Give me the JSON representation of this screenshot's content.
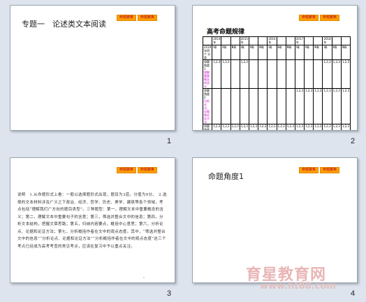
{
  "tags": [
    "命题聚焦",
    "命题聚焦"
  ],
  "slides": [
    {
      "number": "1",
      "title": "专题一　论述类文本阅读"
    },
    {
      "number": "2",
      "title": "高考命题规律",
      "table": {
        "header_row1": [
          "",
          "2014 年",
          "",
          "",
          "2015 年",
          "",
          "",
          "2016 年",
          "",
          "",
          "2017 年",
          "",
          "",
          "2018 年",
          "",
          ""
        ],
        "header_row2": [
          "2019 年四个 分类",
          "Ⅰ卷",
          "Ⅱ卷",
          "Ⅲ卷",
          "Ⅰ卷",
          "Ⅱ卷",
          "Ⅲ卷",
          "Ⅰ卷",
          "Ⅱ卷",
          "Ⅲ卷",
          "Ⅰ卷",
          "Ⅱ卷",
          "Ⅲ卷",
          "Ⅰ卷",
          "Ⅱ卷",
          "Ⅲ卷"
        ],
        "rows": [
          {
            "label": "命题角度1",
            "desc": "理解重要概念的含义",
            "cells": [
              "1,2,3",
              "1,2,3",
              "",
              "1,2,3",
              "",
              "",
              "",
              "",
              "",
              "",
              "",
              "",
              "1,2,3",
              "1,2,3",
              "1,2,3"
            ]
          },
          {
            "label": "命题角度2",
            "desc": "分析论点、论据和论证方法",
            "cells": [
              "",
              "",
              "",
              "",
              "",
              "",
              "",
              "",
              "",
              "1,2,3",
              "1,2,3",
              "1,2,3",
              "1,2,3",
              "1,2,3",
              "1,2,3"
            ]
          },
          {
            "label": "命题角度3",
            "desc": "分析概括作者在文中的观点态度",
            "cells": [
              "1,2,3",
              "1,2,3",
              "1,2,3",
              "1,2,3",
              "1,2,3",
              "1,2,3",
              "1,2,3",
              "1,2,3",
              "1,2,3",
              "1,2,3",
              "1,2,3",
              "1,2,3",
              "1,2,3",
              "1,2,3",
              "1,2,3"
            ]
          }
        ]
      }
    },
    {
      "number": "3",
      "paragraph": "说明　1.从命题形式上看：一般以选择题形式出现，题目为3道，分值为9分。　2.选择的文本材料涉及广义之下政治、经济、哲学、历史、美学、建筑等各个领域，考点包括“理解我们广方向的题目类型”。三种题型：第一，理解文本中重要概念的含义；第二，理解文本中重要句子的含意；第三，筛选并整合文中的信息；第四，分析文本结构，把握文章思路；第五，归纳内容要点，概括中心意思；第六，分析论点、论据和论证方法；第七，分析概括作者在文中的观点态度。其中，“筛选并整合文中的信息”“分析论点、论据和论证方法”“分析概括作者在文中的观点态度”这三个考点已经成为高考考查的常见考点，应该在复习中予以重点关注。"
    },
    {
      "number": "4",
      "title": "命题角度1"
    }
  ],
  "watermark": {
    "brand": "育星教育网",
    "url": "www.ht88.com"
  }
}
